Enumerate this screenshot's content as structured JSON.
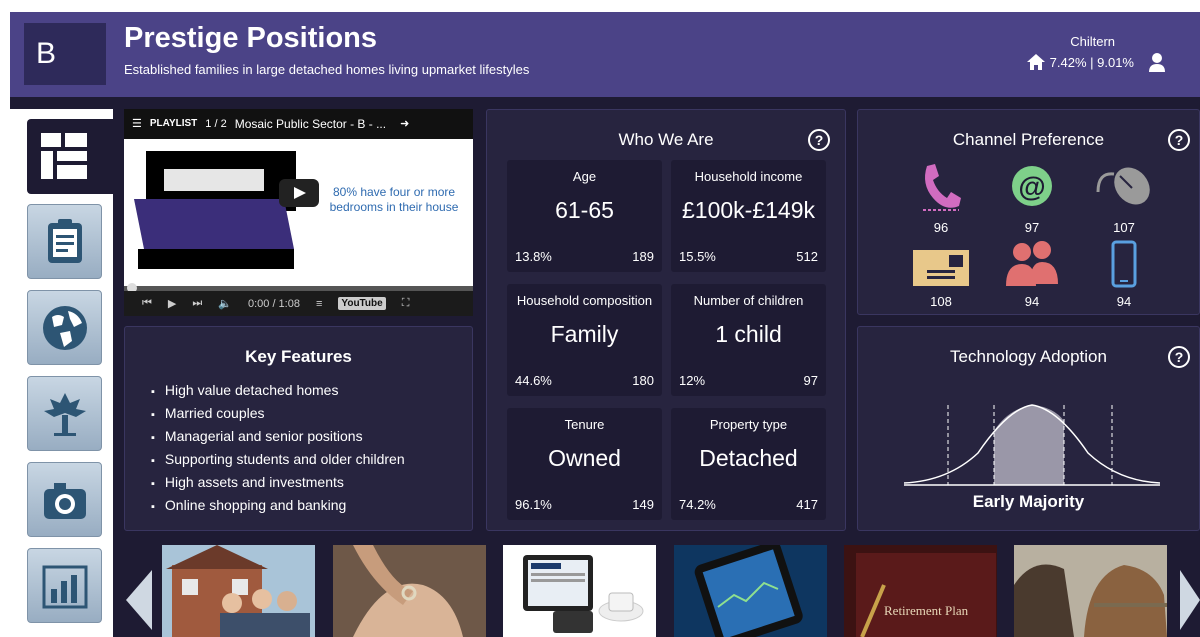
{
  "header": {
    "logo_letter": "B",
    "title": "Prestige Positions",
    "subtitle": "Established families in large detached homes living upmarket lifestyles",
    "region": "Chiltern",
    "region_stats": "7.42% | 9.01%"
  },
  "sidebar": {
    "items": [
      {
        "name": "dashboard-icon",
        "active": true
      },
      {
        "name": "clipboard-icon",
        "active": false
      },
      {
        "name": "globe-icon",
        "active": false
      },
      {
        "name": "tree-icon",
        "active": false
      },
      {
        "name": "camera-icon",
        "active": false
      },
      {
        "name": "bar-chart-icon",
        "active": false
      }
    ]
  },
  "video": {
    "playlist_label": "PLAYLIST",
    "playlist_count": "1 / 2",
    "title": "Mosaic Public Sector - B - ...",
    "caption": "80% have four or more bedrooms in their house",
    "time": "0:00 / 1:08",
    "youtube_label": "YouTube"
  },
  "key_features": {
    "title": "Key Features",
    "items": [
      "High value detached homes",
      "Married couples",
      "Managerial and senior positions",
      "Supporting students and older children",
      "High assets and investments",
      "Online shopping and banking"
    ]
  },
  "who_we_are": {
    "title": "Who We Are",
    "help": "?",
    "tiles": [
      {
        "label": "Age",
        "value": "61-65",
        "pct": "13.8%",
        "index": "189"
      },
      {
        "label": "Household income",
        "value": "£100k-£149k",
        "pct": "15.5%",
        "index": "512"
      },
      {
        "label": "Household composition",
        "value": "Family",
        "pct": "44.6%",
        "index": "180"
      },
      {
        "label": "Number of children",
        "value": "1 child",
        "pct": "12%",
        "index": "97"
      },
      {
        "label": "Tenure",
        "value": "Owned",
        "pct": "96.1%",
        "index": "149"
      },
      {
        "label": "Property type",
        "value": "Detached",
        "pct": "74.2%",
        "index": "417"
      }
    ]
  },
  "channel_preference": {
    "title": "Channel Preference",
    "help": "?",
    "channels": [
      {
        "icon": "phone-icon",
        "value": "96",
        "color": "#d16cc0"
      },
      {
        "icon": "email-icon",
        "value": "97",
        "color": "#7ed08a"
      },
      {
        "icon": "mouse-icon",
        "value": "107",
        "color": "#9a9a9a"
      },
      {
        "icon": "letter-icon",
        "value": "108",
        "color": "#e8c88a"
      },
      {
        "icon": "people-icon",
        "value": "94",
        "color": "#e07070"
      },
      {
        "icon": "mobile-icon",
        "value": "94",
        "color": "#5aa0e0"
      }
    ]
  },
  "technology_adoption": {
    "title": "Technology Adoption",
    "help": "?",
    "label": "Early Majority"
  },
  "carousel": {
    "thumbs": [
      {
        "name": "family-house-thumb"
      },
      {
        "name": "wedding-ring-thumb"
      },
      {
        "name": "tablet-news-thumb"
      },
      {
        "name": "smartphone-stocks-thumb"
      },
      {
        "name": "retirement-plan-thumb",
        "text": "Retirement Plan"
      },
      {
        "name": "ponies-thumb"
      }
    ]
  }
}
